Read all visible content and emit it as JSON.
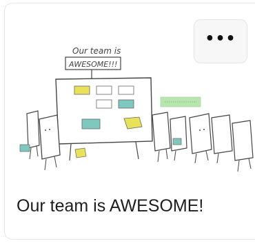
{
  "card": {
    "title": "Our team is AWESOME!",
    "menu_button_label": "•••",
    "thumbnail": {
      "sign_line1": "Our team is",
      "sign_line2": "AWESOME!!!"
    }
  },
  "colors": {
    "sticky_yellow": "#e8e15a",
    "sticky_teal": "#7ec8c0",
    "sticky_green": "#b9e6b0",
    "ink": "#444444"
  }
}
